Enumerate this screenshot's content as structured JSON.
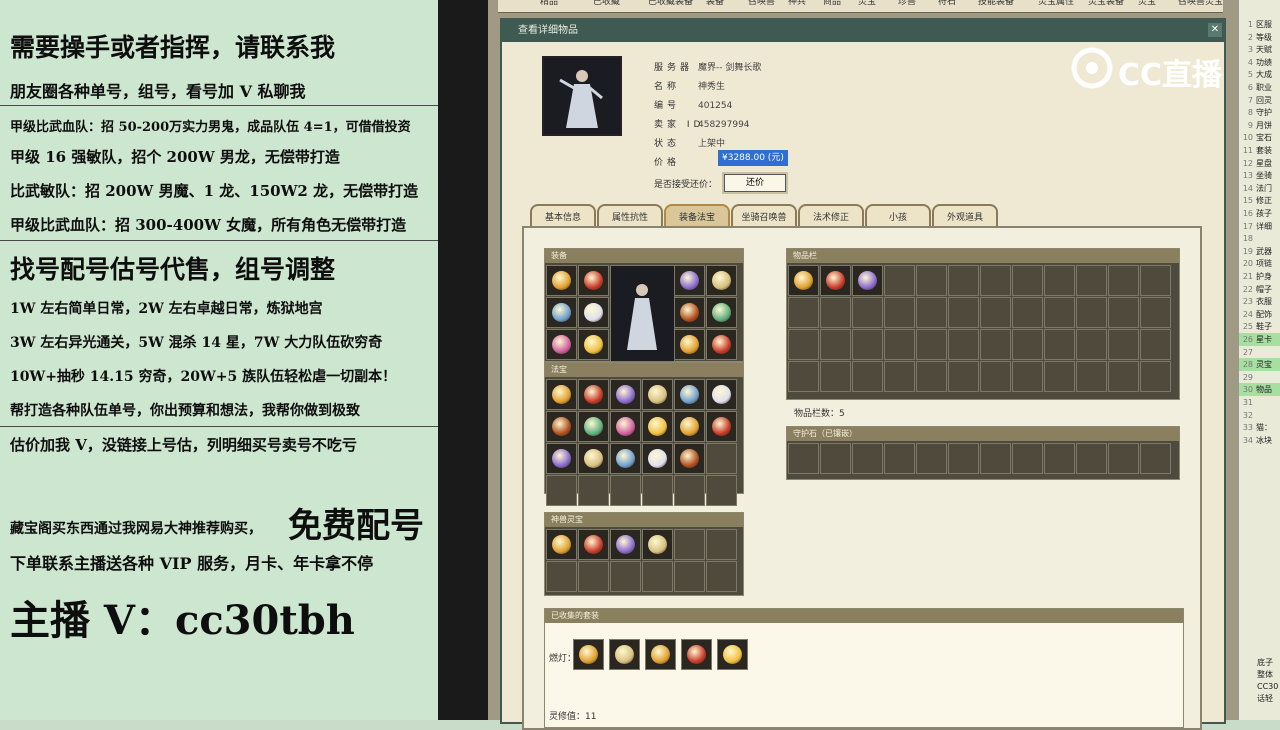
{
  "promo": {
    "lines": [
      "需要操手或者指挥，请联系我",
      "朋友圈各种单号，组号，看号加 V 私聊我",
      "甲级比武血队：招 50-200万实力男鬼，成品队伍 4=1，可借借投资",
      "甲级 16 强敏队，招个 200W 男龙，无偿带打造",
      "比武敏队：招 200W 男魔、1 龙、150W2 龙，无偿带打造",
      "甲级比武血队：招 300-400W 女魔，所有角色无偿带打造",
      "找号配号估号代售，组号调整",
      "1W 左右简单日常，2W 左右卓越日常，炼狱地宫",
      "3W 左右异光通关，5W 混杀 14 星，7W 大力队伍砍穷奇",
      "10W+抽秒 14.15 穷奇，20W+5 族队伍轻松虐一切副本！",
      "帮打造各种队伍单号，你出预算和想法，我帮你做到极致",
      "估价加我 V，没链接上号估，列明细买号卖号不吃亏",
      "藏宝阁买东西通过我网易大神推荐购买，",
      "免费配号",
      "下单联系主播送各种 VIP 服务，月卡、年卡拿不停",
      "主播 V：cc30tbh"
    ]
  },
  "window": {
    "top_tabs": [
      "精品",
      "已收藏",
      "已收藏装备",
      "装备",
      "召唤兽",
      "神兵",
      "商品",
      "灵宝",
      "珍兽",
      "符石",
      "技能装备",
      "灵宝属性",
      "灵宝装备",
      "灵宝",
      "召唤兽灵宝"
    ],
    "panel_title": "查看详细物品",
    "info": [
      {
        "key": "服务器",
        "value": "魔界-- 剑舞长歌"
      },
      {
        "key": "名称",
        "value": "神秀生"
      },
      {
        "key": "编号",
        "value": "401254"
      },
      {
        "key": "卖家 ID",
        "value": "458297994"
      },
      {
        "key": "状态",
        "value": "上架中"
      },
      {
        "key": "价格",
        "value": ""
      }
    ],
    "price": "¥3288.00 (元)",
    "counter_label": "是否接受还价：",
    "counter_button": "还价",
    "sub_tabs": [
      "基本信息",
      "属性抗性",
      "装备法宝",
      "坐骑召唤兽",
      "法术修正",
      "小孩",
      "外观道具"
    ],
    "active_sub_tab": "装备法宝",
    "sections": {
      "equip": "装备",
      "fabao": "法宝",
      "lingbao": "神兽灵宝",
      "inventory": "物品栏",
      "inventory_count": "物品栏数：5",
      "guard": "守护石（已镶嵌）",
      "collected": "已收集的套装",
      "lamp": "燃灯：",
      "value": "灵修值：11"
    }
  },
  "right_strip": {
    "rows": [
      {
        "n": "1",
        "t": "区服"
      },
      {
        "n": "2",
        "t": "等级"
      },
      {
        "n": "3",
        "t": "天赋"
      },
      {
        "n": "4",
        "t": "功绩"
      },
      {
        "n": "5",
        "t": "大成"
      },
      {
        "n": "6",
        "t": "职业"
      },
      {
        "n": "7",
        "t": "回灵"
      },
      {
        "n": "8",
        "t": "守护"
      },
      {
        "n": "9",
        "t": "月饼"
      },
      {
        "n": "10",
        "t": "宝石"
      },
      {
        "n": "11",
        "t": "套装"
      },
      {
        "n": "12",
        "t": "星盘"
      },
      {
        "n": "13",
        "t": "坐骑"
      },
      {
        "n": "14",
        "t": "法门"
      },
      {
        "n": "15",
        "t": "修正"
      },
      {
        "n": "16",
        "t": "孩子"
      },
      {
        "n": "17",
        "t": "详细"
      },
      {
        "n": "18",
        "t": ""
      },
      {
        "n": "19",
        "t": "武器"
      },
      {
        "n": "20",
        "t": "项链"
      },
      {
        "n": "21",
        "t": "护身"
      },
      {
        "n": "22",
        "t": "帽子"
      },
      {
        "n": "23",
        "t": "衣服"
      },
      {
        "n": "24",
        "t": "配饰"
      },
      {
        "n": "25",
        "t": "鞋子"
      },
      {
        "n": "26",
        "t": "星卡"
      },
      {
        "n": "27",
        "t": ""
      },
      {
        "n": "28",
        "t": "灵宝"
      },
      {
        "n": "29",
        "t": ""
      },
      {
        "n": "30",
        "t": "物品"
      },
      {
        "n": "31",
        "t": ""
      },
      {
        "n": "32",
        "t": ""
      },
      {
        "n": "33",
        "t": "猫："
      },
      {
        "n": "34",
        "t": "冰块"
      }
    ],
    "bottom": [
      "底子",
      "整体",
      "CC30",
      "话轻"
    ]
  },
  "overlay": {
    "logo": "CC直播"
  }
}
